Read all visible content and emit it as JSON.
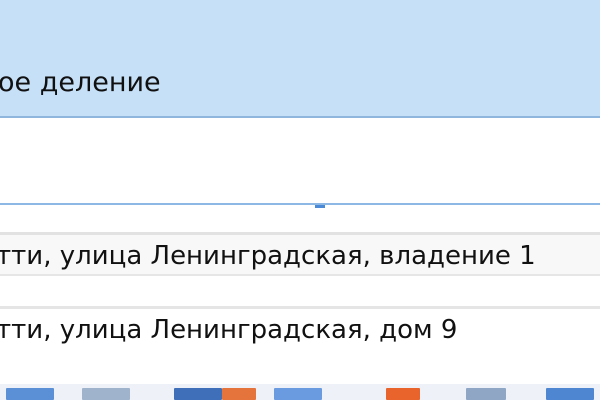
{
  "header": {
    "title": "ое деление"
  },
  "address_list": {
    "rows": [
      {
        "text": "тти, улица Ленинградская, владение 1"
      },
      {
        "text": "тти, улица Ленинградская, дом 9"
      }
    ]
  },
  "colors": {
    "header_background": "#c6e0f8",
    "divider": "#8db8e6",
    "accent": "#4a8ad6"
  },
  "bottom_toolbar": {
    "tiles": [
      {
        "icon": "blue-tile",
        "color": "#5b8fd6"
      },
      {
        "icon": "gray-tile",
        "color": "#9fb3cc"
      },
      {
        "icon": "blue-tile",
        "color": "#3f6fb8"
      },
      {
        "icon": "orange-tile",
        "color": "#e4733c"
      },
      {
        "icon": "blue-tile",
        "color": "#6a9be0"
      },
      {
        "icon": "orange-tile",
        "color": "#e8642c"
      },
      {
        "icon": "gray-tile",
        "color": "#8fa6c4"
      },
      {
        "icon": "blue-tile",
        "color": "#4f86d2"
      }
    ]
  }
}
